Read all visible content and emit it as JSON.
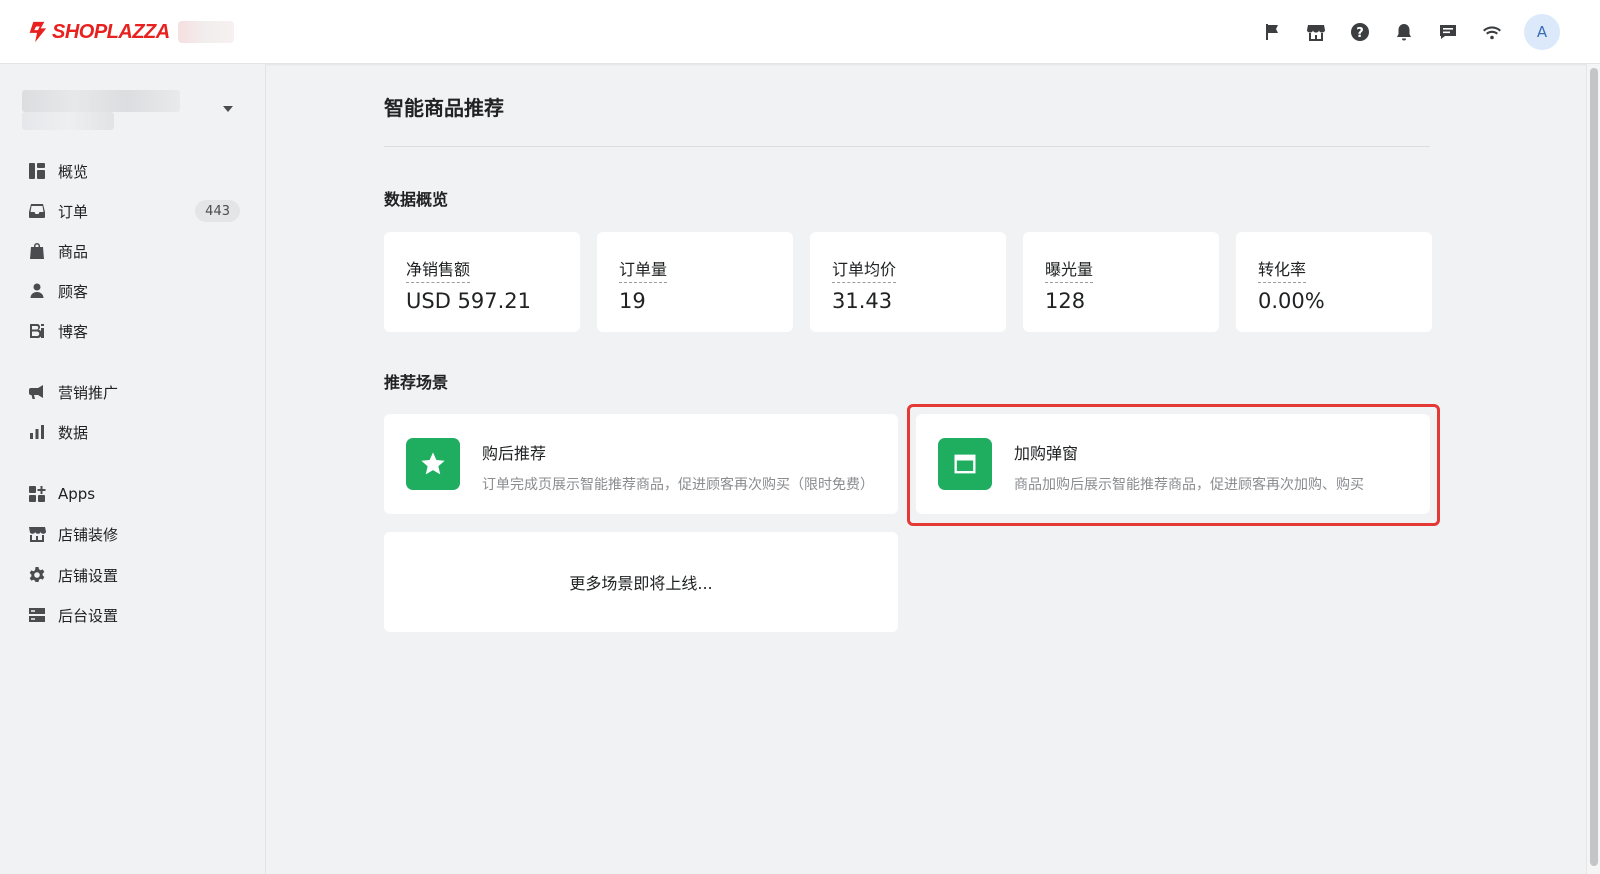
{
  "brand": {
    "name": "SHOPLAZZA",
    "color": "#e8211f"
  },
  "topbar": {
    "icons": [
      "flag-icon",
      "store-icon",
      "help-icon",
      "bell-icon",
      "chat-icon",
      "wifi-icon"
    ],
    "avatar_letter": "A"
  },
  "sidebar": {
    "items": [
      {
        "label": "概览",
        "icon": "dashboard-icon"
      },
      {
        "label": "订单",
        "icon": "inbox-icon",
        "badge": "443"
      },
      {
        "label": "商品",
        "icon": "bag-icon"
      },
      {
        "label": "顾客",
        "icon": "person-icon"
      },
      {
        "label": "博客",
        "icon": "blog-icon"
      },
      {
        "label": "营销推广",
        "icon": "megaphone-icon"
      },
      {
        "label": "数据",
        "icon": "bar-chart-icon"
      },
      {
        "label": "Apps",
        "icon": "apps-icon"
      },
      {
        "label": "店铺装修",
        "icon": "store-icon"
      },
      {
        "label": "店铺设置",
        "icon": "gear-icon"
      },
      {
        "label": "后台设置",
        "icon": "server-icon"
      }
    ]
  },
  "main": {
    "title": "智能商品推荐",
    "overview_title": "数据概览",
    "stats": [
      {
        "label": "净销售额",
        "value": "USD 597.21"
      },
      {
        "label": "订单量",
        "value": "19"
      },
      {
        "label": "订单均价",
        "value": "31.43"
      },
      {
        "label": "曝光量",
        "value": "128"
      },
      {
        "label": "转化率",
        "value": "0.00%"
      }
    ],
    "scenes_title": "推荐场景",
    "scenes": [
      {
        "title": "购后推荐",
        "desc": "订单完成页展示智能推荐商品，促进顾客再次购买（限时免费）",
        "icon": "star-icon"
      },
      {
        "title": "加购弹窗",
        "desc": "商品加购后展示智能推荐商品，促进顾客再次加购、购买",
        "icon": "window-icon"
      }
    ],
    "more": "更多场景即将上线..."
  },
  "colors": {
    "accent_green": "#1fad5f",
    "highlight_red": "#e53935"
  }
}
